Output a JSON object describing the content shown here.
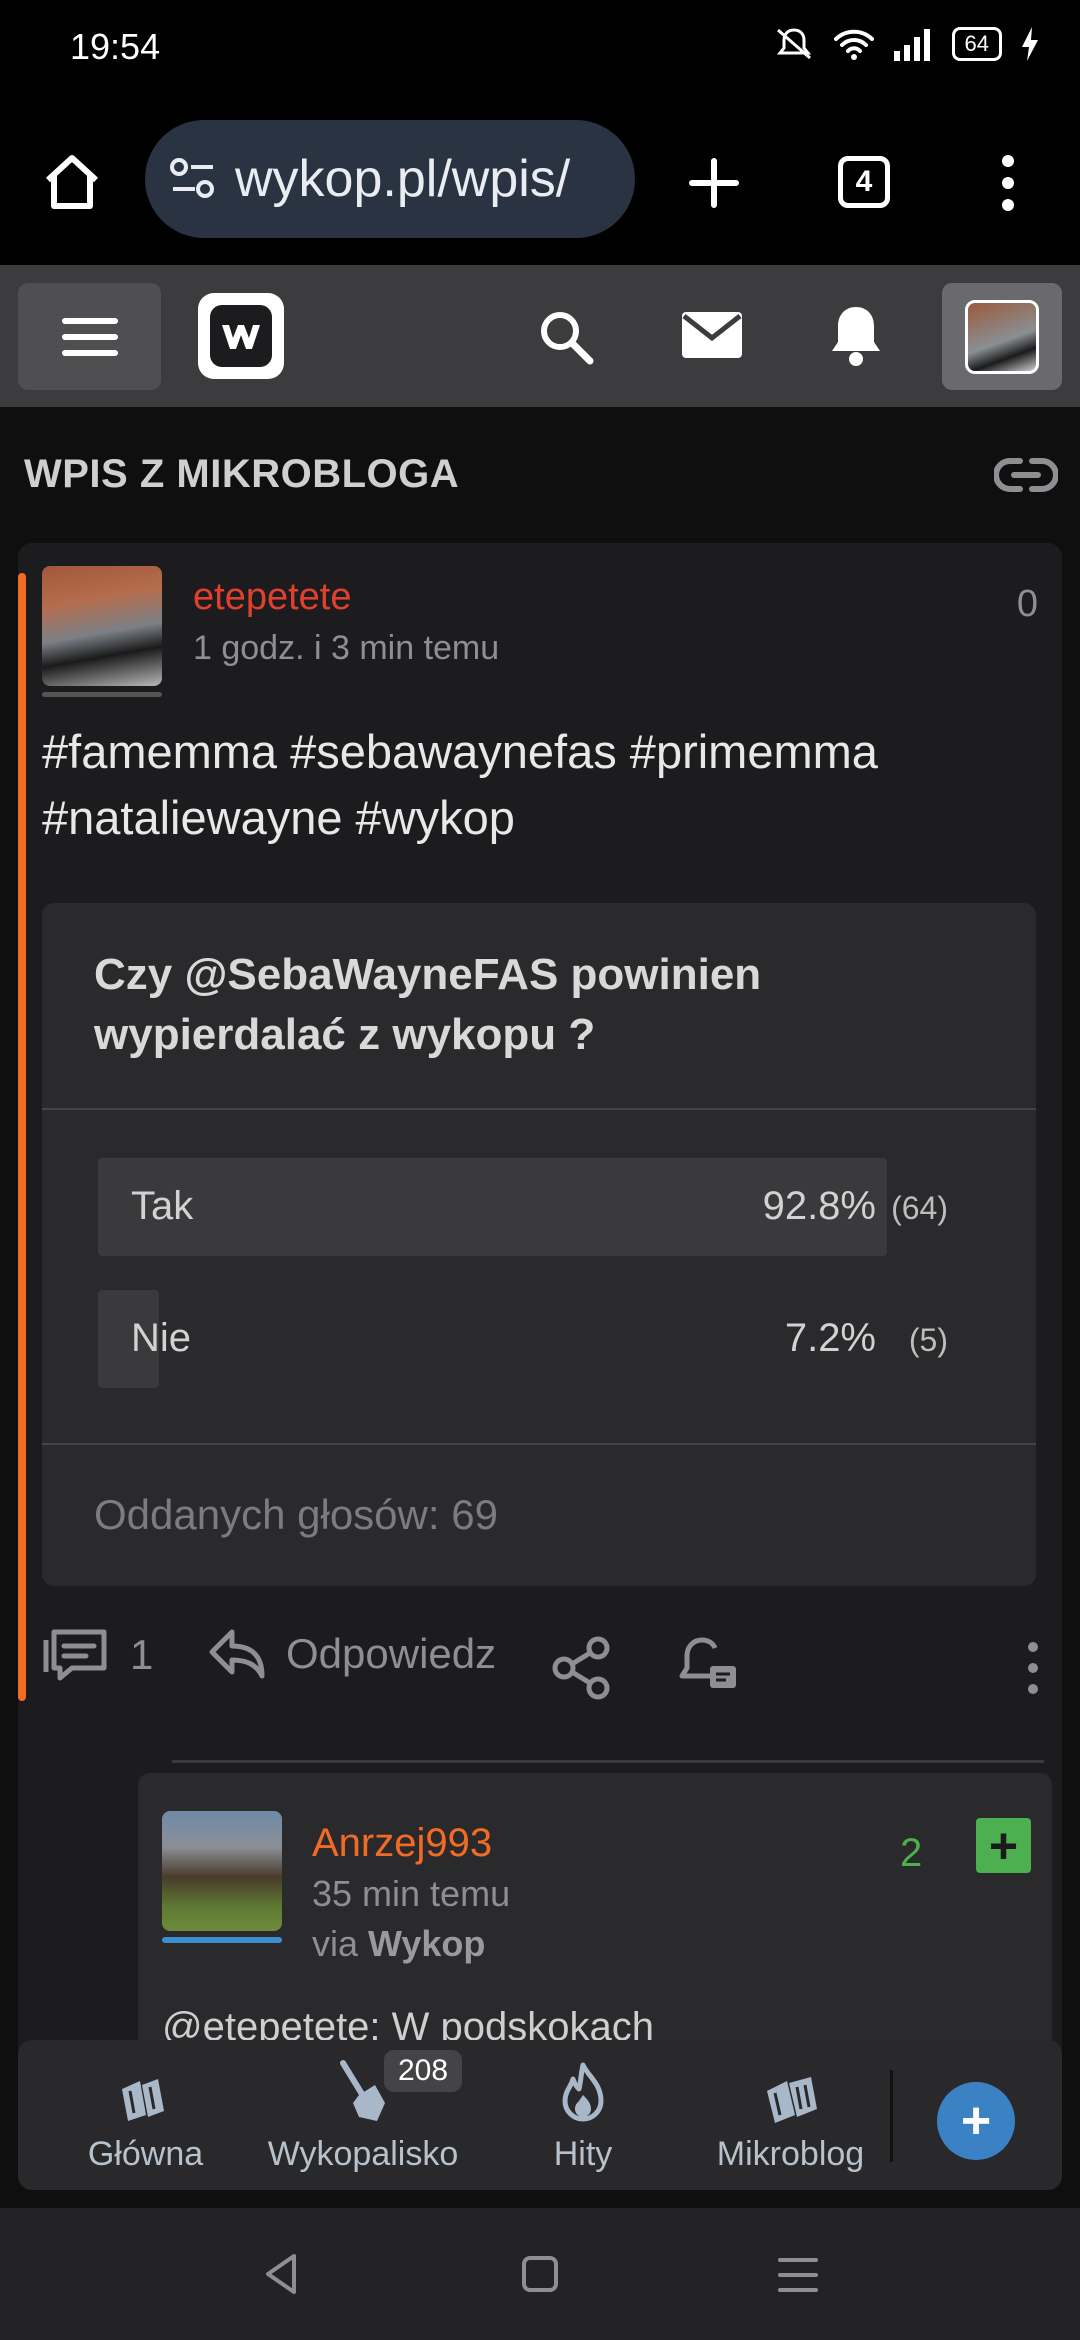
{
  "status_bar": {
    "time": "19:54",
    "battery": "64"
  },
  "browser": {
    "url": "wykop.pl/wpis/",
    "tab_count": "4"
  },
  "page": {
    "title": "WPIS Z MIKROBLOGA"
  },
  "post": {
    "author": "etepetete",
    "time": "1 godz. i 3 min temu",
    "score": "0",
    "text": "#famemma #sebawaynefas #primemma #nataliewayne #wykop",
    "poll": {
      "question": "Czy @SebaWayneFAS powinien wypierdalać z wykopu ?",
      "options": [
        {
          "label": "Tak",
          "percent": "92.8%",
          "count": "(64)",
          "fraction": 0.928
        },
        {
          "label": "Nie",
          "percent": "7.2%",
          "count": "(5)",
          "fraction": 0.072
        }
      ],
      "total": "Oddanych głosów: 69"
    },
    "comment_count": "1",
    "reply_label": "Odpowiedz"
  },
  "reply": {
    "author": "Anrzej993",
    "time": "35 min temu",
    "via_prefix": "via",
    "via_app": "Wykop",
    "score": "2",
    "plus": "+",
    "text": "@etepetete: W podskokach"
  },
  "bottom_nav": {
    "items": [
      {
        "label": "Główna"
      },
      {
        "label": "Wykopalisko"
      },
      {
        "label": "Hity"
      },
      {
        "label": "Mikroblog"
      }
    ],
    "badge": "208",
    "fab": "+"
  },
  "colors": {
    "accent": "#f26b24",
    "author_red": "#e0402e",
    "score_green": "#4caf50",
    "fab_blue": "#3b82c4"
  }
}
